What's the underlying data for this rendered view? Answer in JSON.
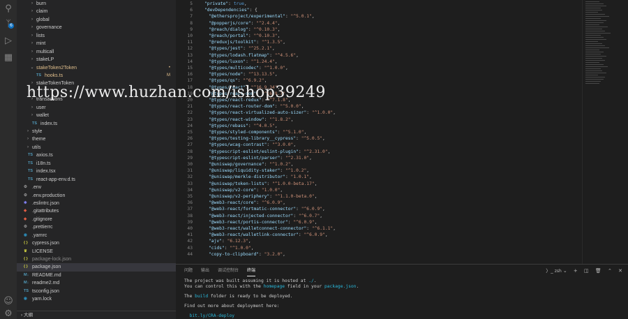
{
  "activity_bar": {
    "icons": [
      "search-icon",
      "source-control-icon",
      "run-debug-icon",
      "extensions-icon",
      "account-icon",
      "settings-icon"
    ],
    "scm_badge": "6"
  },
  "explorer": {
    "rows": [
      {
        "label": "burn",
        "type": "folder",
        "depth": 1,
        "collapsed": true
      },
      {
        "label": "claim",
        "type": "folder",
        "depth": 1,
        "collapsed": true
      },
      {
        "label": "global",
        "type": "folder",
        "depth": 1,
        "collapsed": true
      },
      {
        "label": "governance",
        "type": "folder",
        "depth": 1,
        "collapsed": true
      },
      {
        "label": "lists",
        "type": "folder",
        "depth": 1,
        "collapsed": true
      },
      {
        "label": "mint",
        "type": "folder",
        "depth": 1,
        "collapsed": true
      },
      {
        "label": "multicall",
        "type": "folder",
        "depth": 1,
        "collapsed": true
      },
      {
        "label": "stakeLP",
        "type": "folder",
        "depth": 1,
        "collapsed": true
      },
      {
        "label": "stakeToken2Token",
        "type": "folder",
        "depth": 1,
        "collapsed": false,
        "color": "#e2c08d",
        "badge": "•"
      },
      {
        "label": "hooks.ts",
        "type": "ts",
        "depth": 2,
        "color": "#e2c08d",
        "badge": "M"
      },
      {
        "label": "stakeTokenToken",
        "type": "folder",
        "depth": 1,
        "collapsed": true
      },
      {
        "label": "",
        "type": "folder",
        "depth": 1,
        "collapsed": true
      },
      {
        "label": "transactions",
        "type": "folder",
        "depth": 1,
        "collapsed": true
      },
      {
        "label": "user",
        "type": "folder",
        "depth": 1,
        "collapsed": true
      },
      {
        "label": "wallet",
        "type": "folder",
        "depth": 1,
        "collapsed": true
      },
      {
        "label": "index.ts",
        "type": "ts",
        "depth": 1
      },
      {
        "label": "style",
        "type": "folder",
        "depth": 0,
        "collapsed": true
      },
      {
        "label": "theme",
        "type": "folder",
        "depth": 0,
        "collapsed": true
      },
      {
        "label": "utils",
        "type": "folder",
        "depth": 0,
        "collapsed": true
      },
      {
        "label": "axios.ts",
        "type": "ts",
        "depth": 0
      },
      {
        "label": "i18n.ts",
        "type": "ts",
        "depth": 0
      },
      {
        "label": "index.tsx",
        "type": "tsx",
        "depth": 0
      },
      {
        "label": "react-app-env.d.ts",
        "type": "ts",
        "depth": 0
      },
      {
        "label": ".env",
        "type": "gear",
        "depth": -1
      },
      {
        "label": ".env.production",
        "type": "gear",
        "depth": -1
      },
      {
        "label": ".eslintrc.json",
        "type": "eslint",
        "depth": -1
      },
      {
        "label": ".gitattributes",
        "type": "git",
        "depth": -1
      },
      {
        "label": ".gitignore",
        "type": "git",
        "depth": -1
      },
      {
        "label": ".prettierrc",
        "type": "gear",
        "depth": -1
      },
      {
        "label": ".yarnrc",
        "type": "yarn",
        "depth": -1
      },
      {
        "label": "cypress.json",
        "type": "json",
        "depth": -1
      },
      {
        "label": "LICENSE",
        "type": "license",
        "depth": -1
      },
      {
        "label": "package-lock.json",
        "type": "json",
        "depth": -1,
        "dim": true
      },
      {
        "label": "package.json",
        "type": "json",
        "depth": -1,
        "selected": true
      },
      {
        "label": "README.md",
        "type": "md",
        "depth": -1
      },
      {
        "label": "readme2.md",
        "type": "md",
        "depth": -1
      },
      {
        "label": "tsconfig.json",
        "type": "tsconfig",
        "depth": -1
      },
      {
        "label": "yarn.lock",
        "type": "yarn",
        "depth": -1
      }
    ],
    "outline_label": "大纲"
  },
  "editor": {
    "lines": [
      {
        "n": "5",
        "k": "\"private\"",
        "v": "true",
        "vt": "b"
      },
      {
        "n": "6",
        "k": "\"devDependencies\"",
        "v": "{",
        "vt": "p"
      },
      {
        "n": "7",
        "k": "\"@ethersproject/experimental\"",
        "v": "\"^5.0.1\""
      },
      {
        "n": "8",
        "k": "\"@popperjs/core\"",
        "v": "\"^2.4.4\""
      },
      {
        "n": "9",
        "k": "\"@reach/dialog\"",
        "v": "\"^0.10.3\""
      },
      {
        "n": "10",
        "k": "\"@reach/portal\"",
        "v": "\"^0.10.3\""
      },
      {
        "n": "11",
        "k": "\"@reduxjs/toolkit\"",
        "v": "\"^1.3.5\""
      },
      {
        "n": "12",
        "k": "\"@types/jest\"",
        "v": "\"^25.2.1\""
      },
      {
        "n": "13",
        "k": "\"@types/lodash.flatmap\"",
        "v": "\"^4.5.6\""
      },
      {
        "n": "14",
        "k": "\"@types/luxon\"",
        "v": "\"^1.24.4\""
      },
      {
        "n": "15",
        "k": "\"@types/multicodec\"",
        "v": "\"^1.0.0\""
      },
      {
        "n": "16",
        "k": "\"@types/node\"",
        "v": "\"^13.13.5\""
      },
      {
        "n": "17",
        "k": "\"@types/qs\"",
        "v": "\"^6.9.2\""
      },
      {
        "n": "18",
        "k": "\"@types/react\"",
        "v": "\"^16.9.34\""
      },
      {
        "n": "19",
        "k": "\"@types/react-dom\"",
        "v": "\"^16.9.7\""
      },
      {
        "n": "20",
        "k": "\"@types/react-redux\"",
        "v": "\"^7.1.8\""
      },
      {
        "n": "21",
        "k": "\"@types/react-router-dom\"",
        "v": "\"^5.0.0\""
      },
      {
        "n": "22",
        "k": "\"@types/react-virtualized-auto-sizer\"",
        "v": "\"^1.0.0\""
      },
      {
        "n": "23",
        "k": "\"@types/react-window\"",
        "v": "\"^1.8.2\""
      },
      {
        "n": "24",
        "k": "\"@types/rebass\"",
        "v": "\"^4.0.5\""
      },
      {
        "n": "25",
        "k": "\"@types/styled-components\"",
        "v": "\"^5.1.0\""
      },
      {
        "n": "26",
        "k": "\"@types/testing-library__cypress\"",
        "v": "\"^5.0.5\""
      },
      {
        "n": "27",
        "k": "\"@types/wcag-contrast\"",
        "v": "\"^3.0.0\""
      },
      {
        "n": "28",
        "k": "\"@typescript-eslint/eslint-plugin\"",
        "v": "\"^2.31.0\""
      },
      {
        "n": "29",
        "k": "\"@typescript-eslint/parser\"",
        "v": "\"^2.31.0\""
      },
      {
        "n": "30",
        "k": "\"@uniswap/governance\"",
        "v": "\"^1.0.2\""
      },
      {
        "n": "31",
        "k": "\"@uniswap/liquidity-staker\"",
        "v": "\"^1.0.2\""
      },
      {
        "n": "32",
        "k": "\"@uniswap/merkle-distributor\"",
        "v": "\"1.0.1\""
      },
      {
        "n": "33",
        "k": "\"@uniswap/token-lists\"",
        "v": "\"^1.0.0-beta.17\""
      },
      {
        "n": "34",
        "k": "\"@uniswap/v2-core\"",
        "v": "\"1.0.0\""
      },
      {
        "n": "35",
        "k": "\"@uniswap/v2-periphery\"",
        "v": "\"^1.1.0-beta.0\""
      },
      {
        "n": "36",
        "k": "\"@web3-react/core\"",
        "v": "\"^6.0.9\""
      },
      {
        "n": "37",
        "k": "\"@web3-react/fortmatic-connector\"",
        "v": "\"^6.0.9\""
      },
      {
        "n": "38",
        "k": "\"@web3-react/injected-connector\"",
        "v": "\"^6.0.7\""
      },
      {
        "n": "39",
        "k": "\"@web3-react/portis-connector\"",
        "v": "\"^6.0.9\""
      },
      {
        "n": "40",
        "k": "\"@web3-react/walletconnect-connector\"",
        "v": "\"^6.1.1\""
      },
      {
        "n": "41",
        "k": "\"@web3-react/walletlink-connector\"",
        "v": "\"^6.0.9\""
      },
      {
        "n": "42",
        "k": "\"ajv\"",
        "v": "\"6.12.3\""
      },
      {
        "n": "43",
        "k": "\"cids\"",
        "v": "\"^1.0.0\""
      },
      {
        "n": "44",
        "k": "\"copy-to-clipboard\"",
        "v": "\"3.2.0\""
      }
    ]
  },
  "panel": {
    "tabs": [
      "问题",
      "输出",
      "调试控制台",
      "终端"
    ],
    "active_tab": "终端",
    "terminal_selector": "zsh",
    "terminal": {
      "l1a": "The project was built assuming it is hosted at ",
      "l1b": "./",
      "l1c": ".",
      "l2a": "You can control this with the ",
      "l2b": "homepage",
      "l2c": " field in your ",
      "l2d": "package.json",
      "l2e": ".",
      "l3a": "The ",
      "l3b": "build",
      "l3c": " folder is ready to be deployed.",
      "l4": "Find out more about deployment here:",
      "l5": "  bit.ly/CRA-deploy"
    }
  },
  "watermark": "https://www.huzhan.com/ishop39249",
  "colors": {
    "modified": "#e2c08d",
    "ts_icon": "#519aba",
    "json_icon": "#cbcb41",
    "key": "#9cdcfe",
    "string": "#ce9178",
    "terminal_link": "#29b8db"
  }
}
